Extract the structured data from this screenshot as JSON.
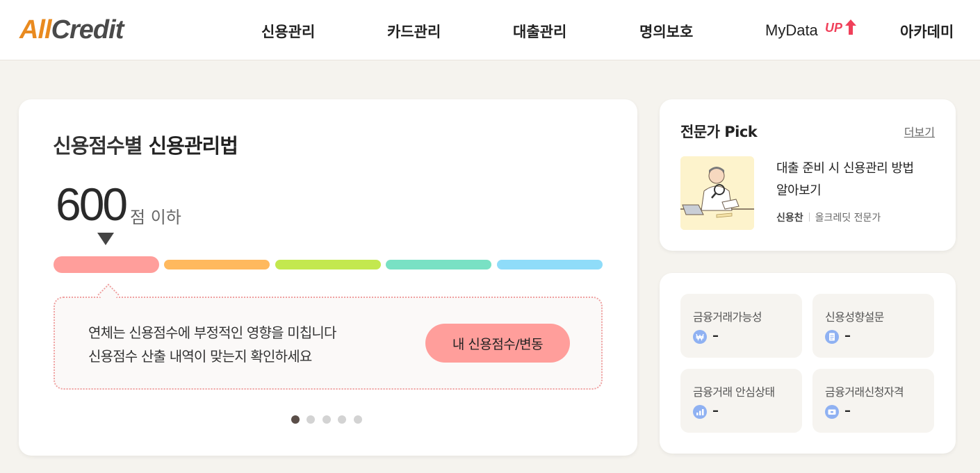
{
  "header": {
    "logo_part1": "All",
    "logo_part2": "Credit",
    "nav": [
      "신용관리",
      "카드관리",
      "대출관리",
      "명의보호",
      "MyData",
      "아카데미"
    ],
    "mydata_badge": "UP"
  },
  "main": {
    "title_light": "신용점수별 ",
    "title_bold": "신용관리법",
    "score": "600",
    "score_suffix": "점 이하",
    "score_segments": [
      "#ff9e9b",
      "#ffb95e",
      "#c3e84f",
      "#79e1c4",
      "#8fdcf9"
    ],
    "active_segment": 1,
    "message_lines": [
      "연체는 신용점수에 부정적인 영향을 미칩니다",
      "신용점수 산출 내역이 맞는지 확인하세요"
    ],
    "button_label": "내 신용점수/변동",
    "slides_total": 5,
    "active_slide": 1
  },
  "pick": {
    "title": "전문가 Pick",
    "more": "더보기",
    "article_title": "대출 준비 시 신용관리 방법 알아보기",
    "author_name": "신용찬",
    "author_role": "올크레딧 전문가"
  },
  "status": {
    "tiles": [
      {
        "label": "금융거래가능성",
        "icon": "won-icon",
        "value": "–"
      },
      {
        "label": "신용성향설문",
        "icon": "document-icon",
        "value": "–"
      },
      {
        "label": "금융거래 안심상태",
        "icon": "signal-bars-icon",
        "value": "–"
      },
      {
        "label": "금융거래신청자격",
        "icon": "card-icon",
        "value": "–"
      }
    ]
  },
  "colors": {
    "accent": "#ff9e9b",
    "logo_orange": "#e98a1f",
    "icon_blue": "#8fb1f2",
    "background": "#f5f3ee"
  }
}
